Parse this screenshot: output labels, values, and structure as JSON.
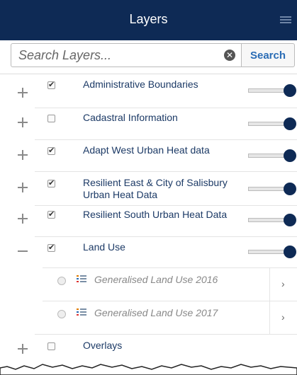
{
  "header": {
    "title": "Layers",
    "menu_icon": "hamburger-icon"
  },
  "search": {
    "placeholder": "Search Layers...",
    "value": "",
    "button_label": "Search",
    "clear_icon": "clear-icon"
  },
  "layers": [
    {
      "label": "Administrative Boundaries",
      "checked": true,
      "expand": "plus"
    },
    {
      "label": "Cadastral Information",
      "checked": false,
      "expand": "plus"
    },
    {
      "label": "Adapt West Urban Heat data",
      "checked": true,
      "expand": "plus"
    },
    {
      "label": "Resilient East & City of Salisbury Urban Heat Data",
      "checked": true,
      "expand": "plus"
    },
    {
      "label": "Resilient South Urban Heat Data",
      "checked": true,
      "expand": "plus"
    },
    {
      "label": "Land Use",
      "checked": true,
      "expand": "minus"
    },
    {
      "label": "Overlays",
      "checked": false,
      "expand": "plus"
    }
  ],
  "sublayers": [
    {
      "label": "Generalised Land Use 2016",
      "selected": false
    },
    {
      "label": "Generalised Land Use 2017",
      "selected": false
    }
  ],
  "colors": {
    "header_bg": "#0e2a55",
    "accent": "#2a6cb5",
    "label": "#1c3a66"
  }
}
